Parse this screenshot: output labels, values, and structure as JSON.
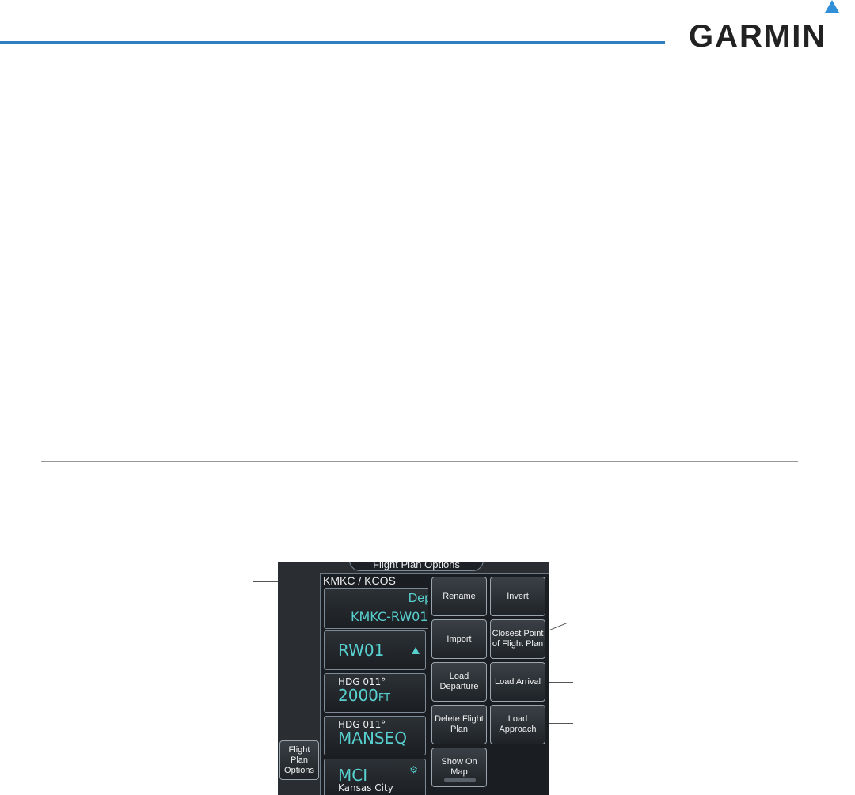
{
  "brand": {
    "logo_text": "GARMIN",
    "accent_color": "#2f7fc0"
  },
  "screen": {
    "tab_title": "Flight Plan Options",
    "route_title": "KMKC / KCOS",
    "departure": {
      "label": "Depa",
      "value": "KMKC-RW01"
    },
    "waypoints": [
      {
        "main": "RW01",
        "indicator": "up-triangle-icon"
      },
      {
        "sub": "HDG 011°",
        "main": "2000",
        "unit": "FT"
      },
      {
        "sub": "HDG 011°",
        "main": "MANSEQ"
      },
      {
        "main": "MCI",
        "sub": "Kansas City",
        "indicator": "gear-icon"
      }
    ],
    "buttons": {
      "rename": "Rename",
      "invert": "Invert",
      "import": "Import",
      "closest": "Closest Point of Flight Plan",
      "load_departure": "Load Departure",
      "load_arrival": "Load Arrival",
      "delete": "Delete Flight Plan",
      "load_approach": "Load Approach",
      "show_on_map": "Show On Map",
      "flight_plan_options": "Flight Plan Options"
    }
  }
}
